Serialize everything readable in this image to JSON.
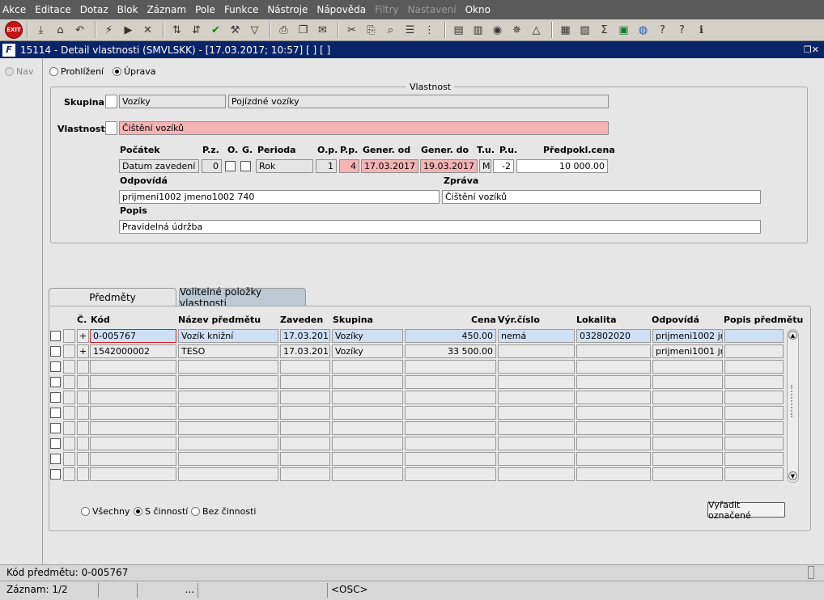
{
  "menu": [
    "Akce",
    "Editace",
    "Dotaz",
    "Blok",
    "Záznam",
    "Pole",
    "Funkce",
    "Nástroje",
    "Nápověda",
    "Filtry",
    "Nastavení",
    "Okno"
  ],
  "menu_disabled": [
    "Filtry",
    "Nastavení"
  ],
  "toolbar": {
    "exit_label": "EXIT"
  },
  "window": {
    "title": "15114 - Detail vlastnosti (SMVLSKK) - [17.03.2017; 10:57]  [ ]  [ ]",
    "logo": "F"
  },
  "nav": {
    "label": "Nav"
  },
  "mode": {
    "browse": "Prohlížení",
    "edit": "Úprava"
  },
  "vlastnost": {
    "group_title": "Vlastnost",
    "skupina_label": "Skupina",
    "skupina_code": "Vozíky",
    "skupina_name": "Pojízdné vozíky",
    "vlastnost_label": "Vlastnost",
    "vlastnost_value": "Čištění vozíků",
    "h_pocatek": "Počátek",
    "h_pz": "P.z.",
    "h_o": "O.",
    "h_g": "G.",
    "h_perioda": "Perioda",
    "h_op": "O.p.",
    "h_pp": "P.p.",
    "h_genod": "Gener. od",
    "h_gendo": "Gener. do",
    "h_tu": "T.u.",
    "h_pu": "P.u.",
    "h_cena": "Předpokl.cena",
    "pocatek": "Datum zavedení",
    "pz": "0",
    "perioda": "Rok",
    "op": "1",
    "pp": "4",
    "genod": "17.03.2017",
    "gendo": "19.03.2017",
    "tu": "M",
    "pu": "-2",
    "cena": "10 000.00",
    "odpovida_label": "Odpovídá",
    "odpovida": "prijmeni1002 jmeno1002 740",
    "zprava_label": "Zpráva",
    "zprava": "Čištění vozíků",
    "popis_label": "Popis",
    "popis": "Pravidelná údržba"
  },
  "tabs": [
    "Předměty",
    "Volitelné položky vlastnosti"
  ],
  "grid": {
    "headers": {
      "c": "Č.",
      "kod": "Kód",
      "nazev": "Název předmětu",
      "zaveden": "Zaveden",
      "skupina": "Skupina",
      "cena": "Cena",
      "vyrcislo": "Výr.číslo",
      "lokalita": "Lokalita",
      "odpovida": "Odpovídá",
      "popis": "Popis předmětu"
    },
    "rows": [
      {
        "plus": "+",
        "kod": "0-005767",
        "nazev": "Vozík knižní",
        "zaveden": "17.03.2017",
        "skupina": "Vozíky",
        "cena": "450.00",
        "vyrcislo": "nemá",
        "lokalita": "032802020",
        "odpovida": "prijmeni1002 jmen",
        "popis": ""
      },
      {
        "plus": "+",
        "kod": "1542000002",
        "nazev": "TESO",
        "zaveden": "17.03.2017",
        "skupina": "Vozíky",
        "cena": "33 500.00",
        "vyrcislo": "",
        "lokalita": "",
        "odpovida": "prijmeni1001 jmen",
        "popis": ""
      }
    ]
  },
  "filter": {
    "all": "Všechny",
    "with": "S činností",
    "without": "Bez činnosti"
  },
  "button_exclude": "Vyřadit označené",
  "status": {
    "line1": "Kód předmětu: 0-005767",
    "record": "Záznam: 1/2",
    "dots": "...",
    "osc": "<OSC>"
  }
}
